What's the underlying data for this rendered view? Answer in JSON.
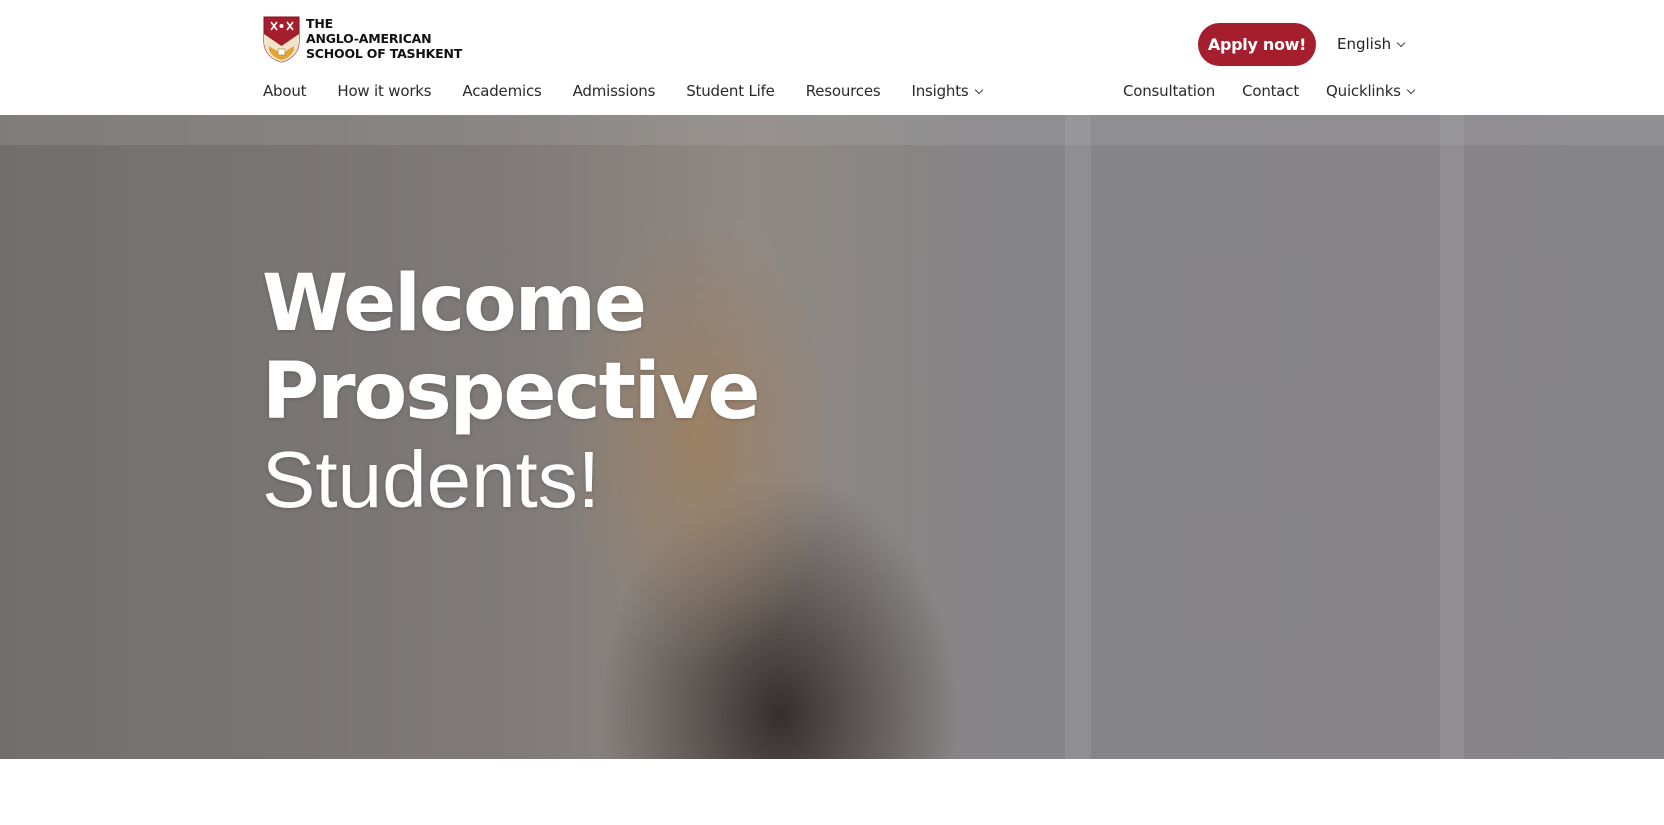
{
  "logo": {
    "line1": "THE",
    "line2": "ANGLO-AMERICAN",
    "line3": "SCHOOL OF TASHKENT",
    "colors": {
      "crest_red": "#a51e2d",
      "crest_gold": "#e3a532"
    }
  },
  "header": {
    "apply_label": "Apply now!",
    "language": "English"
  },
  "nav": {
    "left": [
      {
        "label": "About"
      },
      {
        "label": "How it works"
      },
      {
        "label": "Academics"
      },
      {
        "label": "Admissions"
      },
      {
        "label": "Student Life"
      },
      {
        "label": "Resources"
      },
      {
        "label": "Insights",
        "has_dropdown": true
      }
    ],
    "right": [
      {
        "label": "Consultation"
      },
      {
        "label": "Contact"
      },
      {
        "label": "Quicklinks",
        "has_dropdown": true
      }
    ]
  },
  "hero": {
    "line1": "Welcome",
    "line2": "Prospective",
    "line3": "Students!"
  },
  "colors": {
    "accent": "#a51e2d",
    "text": "#222222",
    "hero_text": "#ffffff"
  }
}
